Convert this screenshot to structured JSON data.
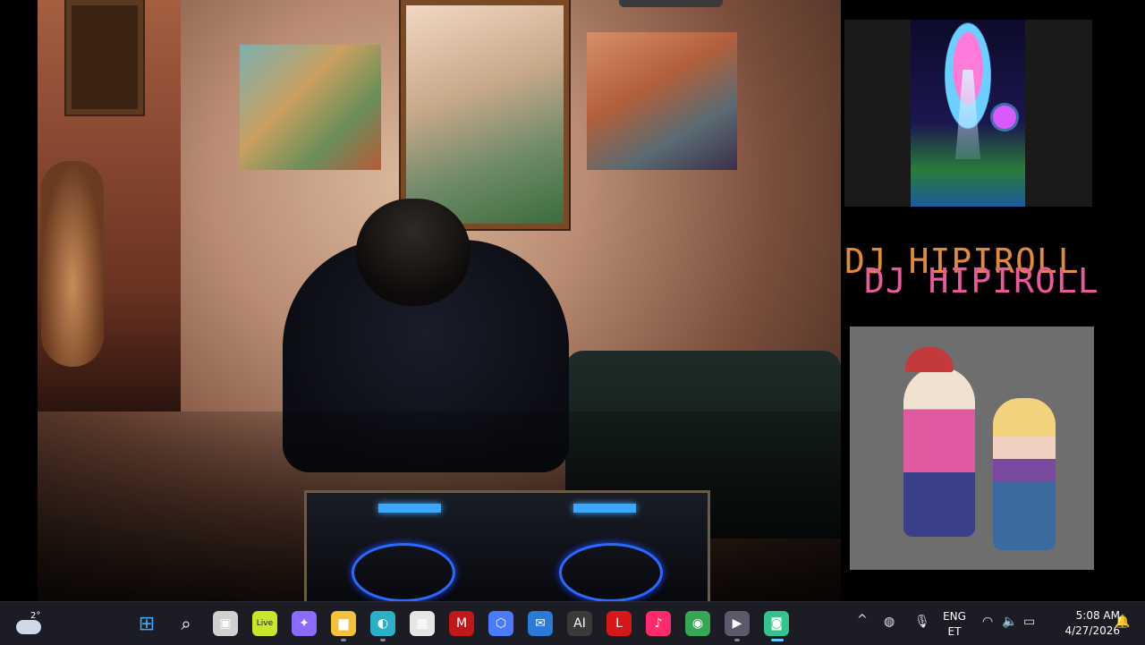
{
  "overlay": {
    "title_text": "DJ HIPIROLL",
    "title_shadow_text": "DJ HIPIROLL"
  },
  "window_controls": {
    "minimize": "—",
    "restore": "❐",
    "close": "✕"
  },
  "taskbar": {
    "weather": {
      "temp": "2°",
      "icon": "partly-cloudy-icon"
    },
    "pinned": [
      {
        "name": "start-icon",
        "glyph": "⊞",
        "color": "#3fa9f5"
      },
      {
        "name": "search-icon",
        "glyph": "⌕",
        "color": "#ffffff"
      },
      {
        "name": "task-view-icon",
        "glyph": "▣",
        "color": "#d0d0d0"
      },
      {
        "name": "live-app-icon",
        "glyph": "Live",
        "color": "#c8e62a"
      },
      {
        "name": "copilot-icon",
        "glyph": "✦",
        "color": "#8a6aff"
      },
      {
        "name": "file-explorer-icon",
        "glyph": "▆",
        "color": "#f2c33a"
      },
      {
        "name": "edge-icon",
        "glyph": "◐",
        "color": "#2ab0c8"
      },
      {
        "name": "store-icon",
        "glyph": "▦",
        "color": "#e6e6e6"
      },
      {
        "name": "mcafee-icon",
        "glyph": "M",
        "color": "#c01818"
      },
      {
        "name": "app-shield-icon",
        "glyph": "⬡",
        "color": "#4a7aff"
      },
      {
        "name": "outlook-icon",
        "glyph": "✉",
        "color": "#2a7ad8"
      },
      {
        "name": "ai-app-icon",
        "glyph": "AI",
        "color": "#3a3a3a"
      },
      {
        "name": "l-app-icon",
        "glyph": "L",
        "color": "#d81818"
      },
      {
        "name": "tiktok-icon",
        "glyph": "♪",
        "color": "#ff2a6a"
      },
      {
        "name": "chrome-icon",
        "glyph": "◉",
        "color": "#34a853"
      },
      {
        "name": "media-player-icon",
        "glyph": "▶",
        "color": "#5a5a6a"
      },
      {
        "name": "streamlabs-icon",
        "glyph": "◙",
        "color": "#31c48d"
      }
    ],
    "tray": {
      "chevron": "^",
      "language_line1": "ENG",
      "language_line2": "ET",
      "time": "5:08 AM",
      "date": "4/27/2026"
    }
  }
}
